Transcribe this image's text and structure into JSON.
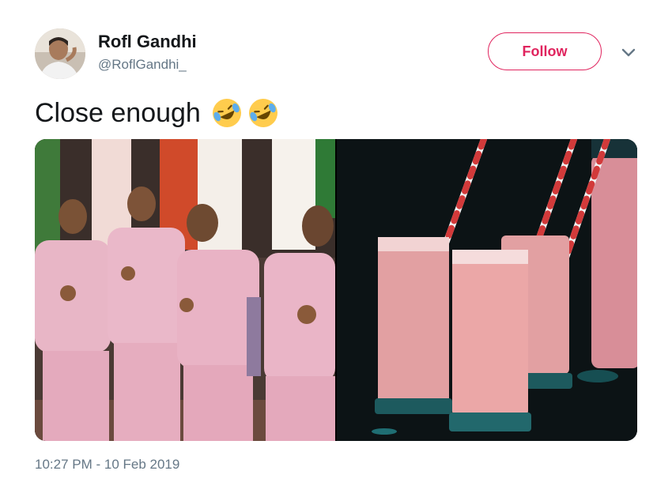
{
  "user": {
    "display_name": "Rofl Gandhi",
    "handle": "@RoflGandhi_"
  },
  "follow_button": {
    "label": "Follow"
  },
  "tweet": {
    "text": "Close enough",
    "emojis": [
      "rolling-on-floor-laughing",
      "rolling-on-floor-laughing"
    ],
    "timestamp": "10:27 PM - 10 Feb 2019"
  },
  "media": {
    "left_image": "group-in-pink-outfits",
    "right_image": "pink-milkshake-glasses-with-striped-straws"
  },
  "colors": {
    "accent": "#e0245e",
    "secondary_text": "#657786",
    "primary_text": "#14171a"
  },
  "icons": [
    "chevron-down-icon",
    "laughing-emoji-icon"
  ]
}
